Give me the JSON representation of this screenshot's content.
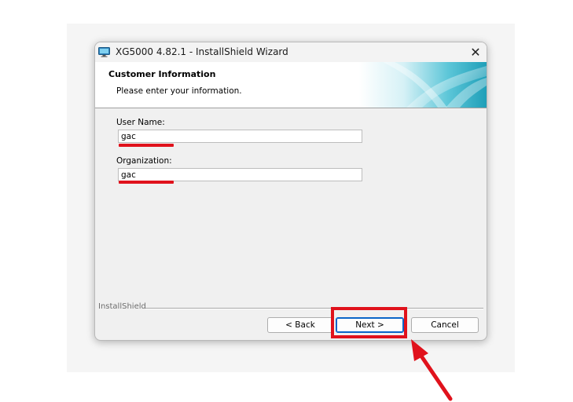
{
  "window": {
    "title": "XG5000 4.82.1 - InstallShield Wizard",
    "close_symbol": "✕"
  },
  "banner": {
    "title": "Customer Information",
    "subtitle": "Please enter your information."
  },
  "form": {
    "user_name": {
      "label": "User Name:",
      "value": "gac"
    },
    "organization": {
      "label": "Organization:",
      "value": "gac"
    }
  },
  "footer": {
    "group_label": "InstallShield",
    "back_label": "< Back",
    "next_label": "Next >",
    "cancel_label": "Cancel"
  },
  "colors": {
    "annotation_red": "#e0121c",
    "default_button_border": "#0a64c8",
    "banner_teal": "#2fb2c8"
  },
  "icons": {
    "app": "monitor-icon",
    "close": "close-icon",
    "annotation": "arrow-up-left-icon"
  }
}
